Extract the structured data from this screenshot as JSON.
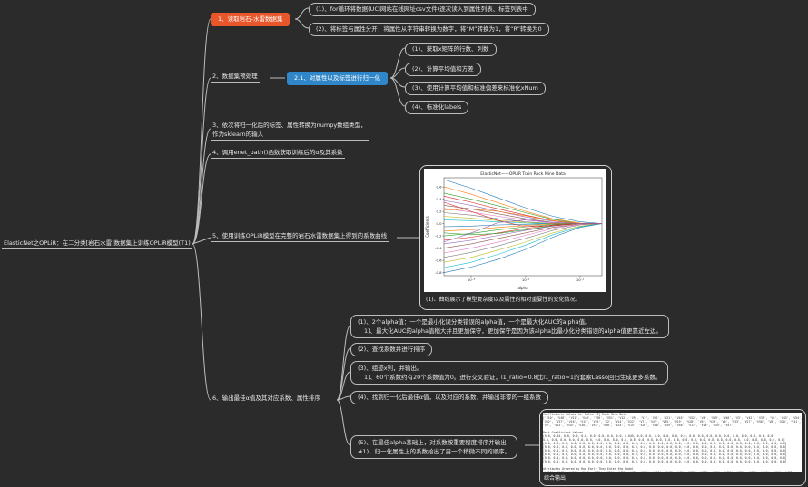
{
  "root": "ElasticNet之OPLiR：在二分类[岩石水雷]数据集上训练OPLiR模型(T1)",
  "branches": {
    "b1": "1、读取岩石-水雷数据集",
    "b1_1": "(1)、for循环将数据(UCI网站在线网址csv文件)逐次读入到属性列表、标签列表中",
    "b1_2": "(2)、将标签与属性分开，将属性从字符串转换为数字，将“M”转换为1，将“R”转换为0",
    "b2": "2、数据集预处理",
    "b2_1": "2.1、对属性以及标签进行归一化",
    "b2_1_1": "(1)、获取x矩阵的行数、列数",
    "b2_1_2": "(2)、计算平均值和方差",
    "b2_1_3": "(3)、使用计算平均值和标准偏差来标准化xNum",
    "b2_1_4": "(4)、标准化labels",
    "b3_line1": "3、依次将归一化后的标签、属性转换为numpy数组类型，",
    "b3_line2": "作为sklearn的输入",
    "b4": "4、调用enet_path()函数获取训练后的α及其系数",
    "b5": "5、使用训练OPLiR模型在完整的岩石水雷数据集上得到的系数曲线",
    "b5_caption": "(1)、曲线展示了模型复杂度以及属性的相对重要性的变化情况。",
    "b6": "6、输出最佳α值及其对应系数、属性排序",
    "b6_1_line1": "(1)、2个alpha值：一个是最小化误分类错误的alpha值，一个是最大化AUC的alpha值。",
    "b6_1_line2": "1)、最大化AUC的alpha值稍大并且更加保守，更加保守是因为该alpha比最小化分类错误的alpha值更靠近左边。",
    "b6_2": "(2)、查找系数并进行排序",
    "b6_3_line1": "(3)、组迹x列，并输出。",
    "b6_3_line2": "1)、60个系数约有20个系数值为0。进行交叉验证，l1_ratio=0.8比l1_ratio=1的套索Lasso回归生成更多系数。",
    "b6_4": "(4)、找到归一化后最佳α值，以及对应的系数，并输出非零的一组系数",
    "b6_5_line1": "(5)、在最佳alpha基础上，对系数按重要程度排序并输出",
    "b6_5_line2": "#1)、归一化属性上的系数给出了另一个稍微不同的顺序。",
    "b6_5_caption": "综合输出"
  },
  "chart_data": {
    "type": "line",
    "title": "ElasticNet——OPLiR Train Rock Mine Data",
    "xlabel": "alpha",
    "ylabel": "Coefficients",
    "xscale": "log",
    "xticks": [
      "10⁻³",
      "10⁻²",
      "10⁻¹"
    ],
    "yticks": [
      "0.6",
      "0.4",
      "0.2",
      "0.0",
      "-0.2",
      "-0.4",
      "-0.6",
      "-0.8"
    ],
    "ylim": [
      -0.85,
      0.75
    ],
    "grid": false,
    "x_log10": [
      -3.5,
      -3.0,
      -2.5,
      -2.0,
      -1.5,
      -1.0,
      -0.6
    ],
    "series": [
      {
        "values": [
          0.72,
          0.58,
          0.42,
          0.26,
          0.12,
          0.03,
          0.0
        ]
      },
      {
        "values": [
          0.6,
          0.48,
          0.34,
          0.2,
          0.08,
          0.01,
          0.0
        ]
      },
      {
        "values": [
          0.5,
          0.4,
          0.29,
          0.18,
          0.07,
          0.0,
          0.0
        ]
      },
      {
        "values": [
          0.45,
          0.35,
          0.24,
          0.14,
          0.05,
          0.0,
          0.0
        ]
      },
      {
        "values": [
          0.38,
          0.3,
          0.2,
          0.11,
          0.04,
          0.0,
          0.0
        ]
      },
      {
        "values": [
          0.3,
          0.24,
          0.16,
          0.08,
          0.02,
          0.0,
          0.0
        ]
      },
      {
        "values": [
          0.25,
          0.19,
          0.12,
          0.06,
          0.01,
          0.0,
          0.0
        ]
      },
      {
        "values": [
          0.18,
          0.14,
          0.08,
          0.03,
          0.0,
          0.0,
          0.0
        ]
      },
      {
        "values": [
          0.12,
          0.09,
          0.05,
          0.02,
          0.0,
          0.0,
          0.0
        ]
      },
      {
        "values": [
          0.06,
          0.05,
          0.03,
          0.01,
          0.0,
          0.0,
          0.0
        ]
      },
      {
        "values": [
          -0.05,
          -0.04,
          -0.02,
          -0.01,
          0.0,
          0.0,
          0.0
        ]
      },
      {
        "values": [
          -0.12,
          -0.1,
          -0.06,
          -0.03,
          0.0,
          0.0,
          0.0
        ]
      },
      {
        "values": [
          -0.2,
          -0.16,
          -0.1,
          -0.05,
          -0.01,
          0.0,
          0.0
        ]
      },
      {
        "values": [
          -0.27,
          -0.22,
          -0.15,
          -0.08,
          -0.02,
          0.0,
          0.0
        ]
      },
      {
        "values": [
          -0.33,
          -0.27,
          -0.19,
          -0.11,
          -0.04,
          0.0,
          0.0
        ]
      },
      {
        "values": [
          -0.4,
          -0.33,
          -0.24,
          -0.15,
          -0.06,
          -0.01,
          0.0
        ]
      },
      {
        "values": [
          -0.48,
          -0.4,
          -0.3,
          -0.19,
          -0.08,
          -0.01,
          0.0
        ]
      },
      {
        "values": [
          -0.55,
          -0.47,
          -0.36,
          -0.24,
          -0.11,
          -0.02,
          0.0
        ]
      },
      {
        "values": [
          -0.63,
          -0.55,
          -0.43,
          -0.3,
          -0.15,
          -0.04,
          0.0
        ]
      },
      {
        "values": [
          -0.72,
          -0.63,
          -0.5,
          -0.35,
          -0.18,
          -0.05,
          0.0
        ]
      },
      {
        "values": [
          -0.8,
          -0.71,
          -0.58,
          -0.42,
          -0.22,
          -0.06,
          0.0
        ]
      },
      {
        "values": [
          0.22,
          0.24,
          0.2,
          0.13,
          0.05,
          0.0,
          0.0
        ]
      },
      {
        "values": [
          -0.15,
          -0.18,
          -0.16,
          -0.1,
          -0.03,
          0.0,
          0.0
        ]
      },
      {
        "values": [
          0.35,
          0.2,
          0.05,
          -0.05,
          -0.03,
          0.0,
          0.0
        ]
      },
      {
        "values": [
          -0.3,
          -0.15,
          0.02,
          0.06,
          0.02,
          0.0,
          0.0
        ]
      }
    ]
  },
  "output_panel": {
    "lines": [
      "Coefficients Values for Rules [I] Rock Mine Data",
      "['V10', 'V48', 'V11', 'V44', 'V36', 'V51', 'V12', 'V9', 'V1', 'V31', 'V21', 'V45', 'V52', 'V4', 'V49', 'V46', 'V3', 'V42', 'V39', 'V0', 'V43', 'V54', 'V56',",
      "'V32', 'V37', 'V16', 'V13', 'V25', 'V2', 'V14', 'V22', 'V7', 'V47', 'V35', 'V19', 'V28', 'V5', 'V29', 'V6', 'V33', 'V27', 'V50', 'V8', 'V20', 'V41',",
      "'V5', 'V23', 'V34', 'V38', 'V53', 'V30', 'V24', 'V15', 'V26', 'V40', 'V59', 'V58', 'V17', 'V18', 'V55', 'V57']",
      "",
      "Best Coefficient Values",
      "[0.0, 0.04, 0.0, 0.0, 0.0, 0.0, 0.0, 0.0, 0.0, 0.045, 0.0, 0.0, 0.0, 0.0, 0.0, 0.0, 0.0, 0.0, 0.0, 0.0, 0.0, 0.0, 0.0, 0.0, 0.0, 0.0,",
      "0.0, 0.0, 0.0, 0.0, 0.0, 0.0, 0.0, 0.0, 0.0, 0.0, 0.0, 0.0, 0.0, 0.0, 0.0, 0.0, 0.0, 0.0, 0.0, 0.0, 0.0, 0.0, 0.0, 0.0, 0.0, 0.0, 0.0, 0.0]",
      "[0.0, 0.0, 0.0, 0.0, 0.0, 0.0, 0.0, 0.0, 0.0, 0.0, 0.0, 0.0, 0.0, 0.0, 0.0, 0.0, 0.0, 0.0, 0.0, 0.0, 0.0, 0.0, 0.0, 0.0, 0.0, 0.0, 0.0, 0.0]",
      "[0.0, 0.0, 0.0, 0.0, 0.0, 0.0, 0.0, 0.0, 0.0, 0.0, 0.0, 0.0, 0.0, 0.0, 0.0, 0.0, 0.0, 0.0, 0.0, 0.0, 0.0, 0.0, 0.0, 0.0, 0.0, 0.0, 0.0, 0.0]",
      "[0.0, 0.0, 0.0, 0.0, 0.0, 0.0, 0.0, 0.0, 0.0, 0.0, 0.0, 0.0, 0.0, 0.0, 0.0, 0.0, 0.0, 0.0, 0.0, 0.0, 0.0, 0.0, 0.0, 0.0, 0.0, 0.0, 0.0, 0.0]",
      "[0.0, 0.0, 0.0, 0.0, 0.0, 0.0, 0.0, 0.0, 0.0, 0.0, 0.0, 0.0, 0.0, 0.0, 0.0, 0.0, 0.0, 0.0, 0.0, 0.0, 0.0, 0.0, 0.0, 0.0, 0.0, 0.0, 0.0, 0.0]",
      "[0.0, 0.0, 0.0, 0.0, 0.0, 0.0, 0.0, 0.0, 0.0, 0.0, 0.0, 0.0, 0.0, 0.0, 0.0, 0.0, 0.0, 0.0, 0.0, 0.0, 0.0, 0.0, 0.0, 0.0, 0.0, 0.0, 0.0, 0.0]",
      "[0.0, 0.0, 0.0, 0.0, 0.0, 0.0, 0.0, 0.0, 0.0, 0.0, 0.0, 0.0, 0.0, 0.0, 0.0, 0.0, 0.0, 0.0, 0.0, 0.0, 0.0, 0.0, 0.0, 0.0, 0.0, 0.0, 0.0, 0.0]",
      "",
      "Attributes Ordered by How Early They Enter the Model",
      "['V10', 'V48', 'V11', 'V44', 'V35', 'V51', 'V20', 'V3', 'V21', 'V15', 'V43', 'V0', 'V22', 'V27', 'V50', 'V53', 'V30', 'V58', 'V46', 'V56', 'V28',",
      "'V39', 'V36', 'V49', 'V4', 'V12', 'V31', 'V1', 'V2', 'V37', 'V52', 'V5', 'V47', 'V54', 'V8', 'V19', 'V45', 'V41', 'V9', 'V6', 'V14']"
    ]
  }
}
